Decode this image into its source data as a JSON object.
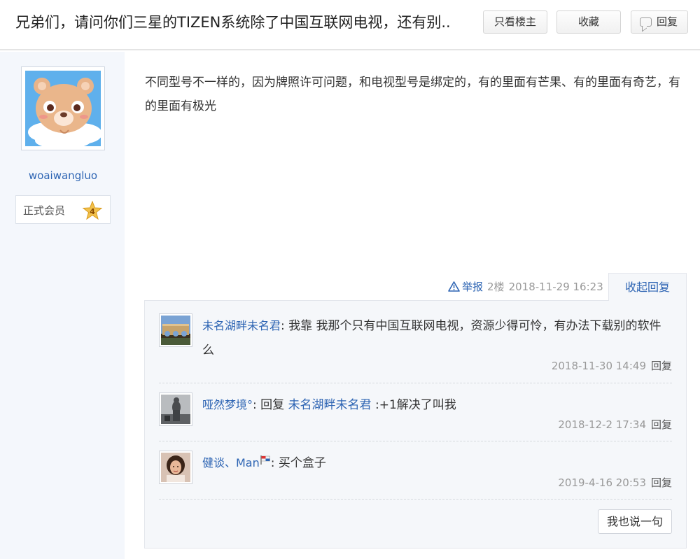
{
  "thread": {
    "title": "兄弟们，请问你们三星的TIZEN系统除了中国互联网电视，还有别..",
    "only_op_label": "只看楼主",
    "favorite_label": "收藏",
    "reply_label": "回复"
  },
  "author": {
    "username": "woaiwangluo",
    "level_name": "正式会员",
    "level_num": "4"
  },
  "post": {
    "content": "不同型号不一样的，因为牌照许可问题，和电视型号是绑定的，有的里面有芒果、有的里面有奇艺，有的里面有极光",
    "report_label": "举报",
    "floor": "2楼",
    "time": "2018-11-29 16:23",
    "collapse_label": "收起回复"
  },
  "replies": [
    {
      "name": "未名湖畔未名君",
      "sep": ":",
      "text": " 我靠 我那个只有中国互联网电视，资源少得可怜，有办法下载别的软件么",
      "time": "2018-11-30 14:49",
      "reply_label": "回复"
    },
    {
      "name": "哑然梦境°",
      "sep": ": 回复 ",
      "to": "未名湖畔未名君",
      "text": " :+1解决了叫我",
      "time": "2018-12-2 17:34",
      "reply_label": "回复"
    },
    {
      "name": "健谈、Man",
      "sep": ":",
      "text": " 买个盒子",
      "time": "2019-4-16 20:53",
      "reply_label": "回复"
    }
  ],
  "say_label": "我也说一句",
  "colors": {
    "link": "#2d64b3",
    "meta": "#999999",
    "sidebar_bg": "#f4f7fc",
    "reply_bg": "#f5f7fa"
  },
  "icons": [
    "reply-icon",
    "warning-icon",
    "level-star-icon",
    "flag-icon"
  ]
}
